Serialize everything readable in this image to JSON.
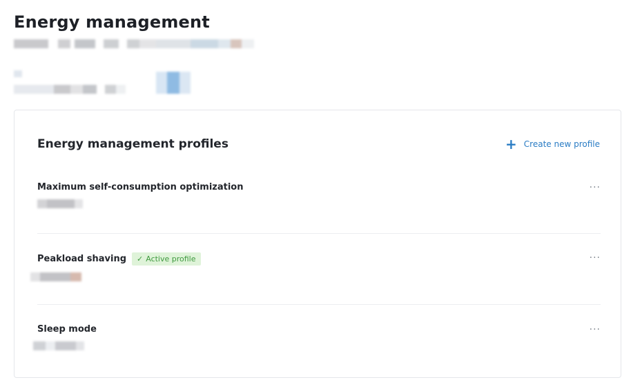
{
  "page": {
    "title": "Energy management"
  },
  "card": {
    "title": "Energy management profiles",
    "create_label": "Create new profile",
    "more_label": "···"
  },
  "profiles": [
    {
      "name": "Maximum self-consumption optimization",
      "badge": null
    },
    {
      "name": "Peakload shaving",
      "badge": "Active profile"
    },
    {
      "name": "Sleep mode",
      "badge": null
    }
  ],
  "colors": {
    "accent": "#2a7cc4",
    "active_badge_bg": "#dff3d9",
    "active_badge_text": "#3f9a3f"
  },
  "icons": {
    "create": "plus-icon",
    "active": "check-icon",
    "more": "more-horizontal-icon"
  }
}
